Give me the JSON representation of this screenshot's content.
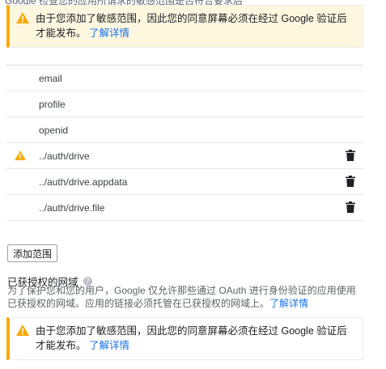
{
  "top_notice": {
    "cut_text": "Google 检查您的应用所请求的敏感范围是否符合要求后",
    "text": "由于您添加了敏感范围，因此您的同意屏幕必须在经过 Google 验证后才能发布。",
    "link": "了解详情"
  },
  "scopes": [
    {
      "name": "email",
      "warning": false,
      "deletable": false
    },
    {
      "name": "profile",
      "warning": false,
      "deletable": false
    },
    {
      "name": "openid",
      "warning": false,
      "deletable": false
    },
    {
      "name": "../auth/drive",
      "warning": true,
      "deletable": true
    },
    {
      "name": "../auth/drive.appdata",
      "warning": false,
      "deletable": true
    },
    {
      "name": "../auth/drive.file",
      "warning": false,
      "deletable": true
    }
  ],
  "add_scope_label": "添加范围",
  "authorized_domains": {
    "title": "已获授权的网域",
    "help_icon": "?",
    "description": "为了保护您和您的用户，Google 仅允许那些通过 OAuth 进行身份验证的应用使用已获授权的网域。应用的链接必须托管在已获授权的网域上。",
    "link": "了解详情"
  },
  "bottom_notice": {
    "text": "由于您添加了敏感范围，因此您的同意屏幕必须在经过 Google 验证后才能发布。",
    "link": "了解详情"
  },
  "colors": {
    "warning": "#f9ab00",
    "link": "#1a73e8",
    "icon_dark": "#202124"
  },
  "icons": {
    "warning": "warning-icon",
    "delete": "trash-icon",
    "help": "help-icon"
  }
}
